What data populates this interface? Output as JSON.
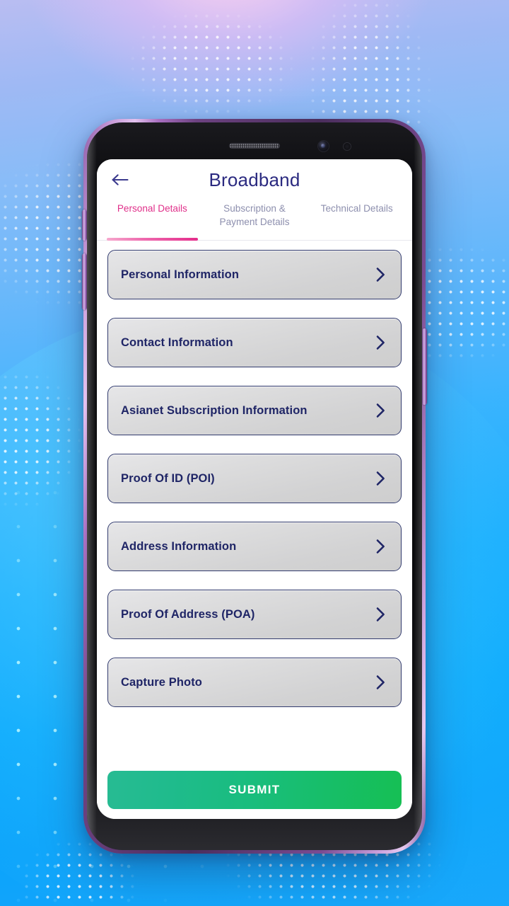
{
  "app": {
    "appbar": {
      "back_icon": "arrow-left-icon",
      "title": "Broadband"
    },
    "tabs": [
      {
        "label": "Personal Details",
        "active": true
      },
      {
        "label": "Subscription & Payment Details",
        "active": false
      },
      {
        "label": "Technical Details",
        "active": false
      }
    ],
    "list_items": [
      {
        "label": "Personal Information",
        "chevron": "chevron-right-icon"
      },
      {
        "label": "Contact Information",
        "chevron": "chevron-right-icon"
      },
      {
        "label": "Asianet Subscription Information",
        "chevron": "chevron-right-icon"
      },
      {
        "label": "Proof Of ID (POI)",
        "chevron": "chevron-right-icon"
      },
      {
        "label": "Address Information",
        "chevron": "chevron-right-icon"
      },
      {
        "label": "Proof Of Address (POA)",
        "chevron": "chevron-right-icon"
      },
      {
        "label": "Capture Photo",
        "chevron": "chevron-right-icon"
      }
    ],
    "submit": {
      "label": "SUBMIT"
    },
    "colors": {
      "title": "#2b2a80",
      "tab_active": "#e0308a",
      "tab_inactive": "#8d8fae",
      "card_text": "#1f2566",
      "card_border": "#323b6e",
      "submit_gradient_start": "#27bb93",
      "submit_gradient_end": "#16bf54",
      "screen_background": "#ffffff"
    }
  },
  "device": {
    "frame_color": "#7d4f95",
    "bezel_color": "#08080a",
    "speaker": "earpiece-speaker",
    "front_camera": "front-camera-icon",
    "sensor": "proximity-sensor-icon"
  },
  "background": {
    "style": "blue-purple-gradient-with-dotted-world-map"
  }
}
